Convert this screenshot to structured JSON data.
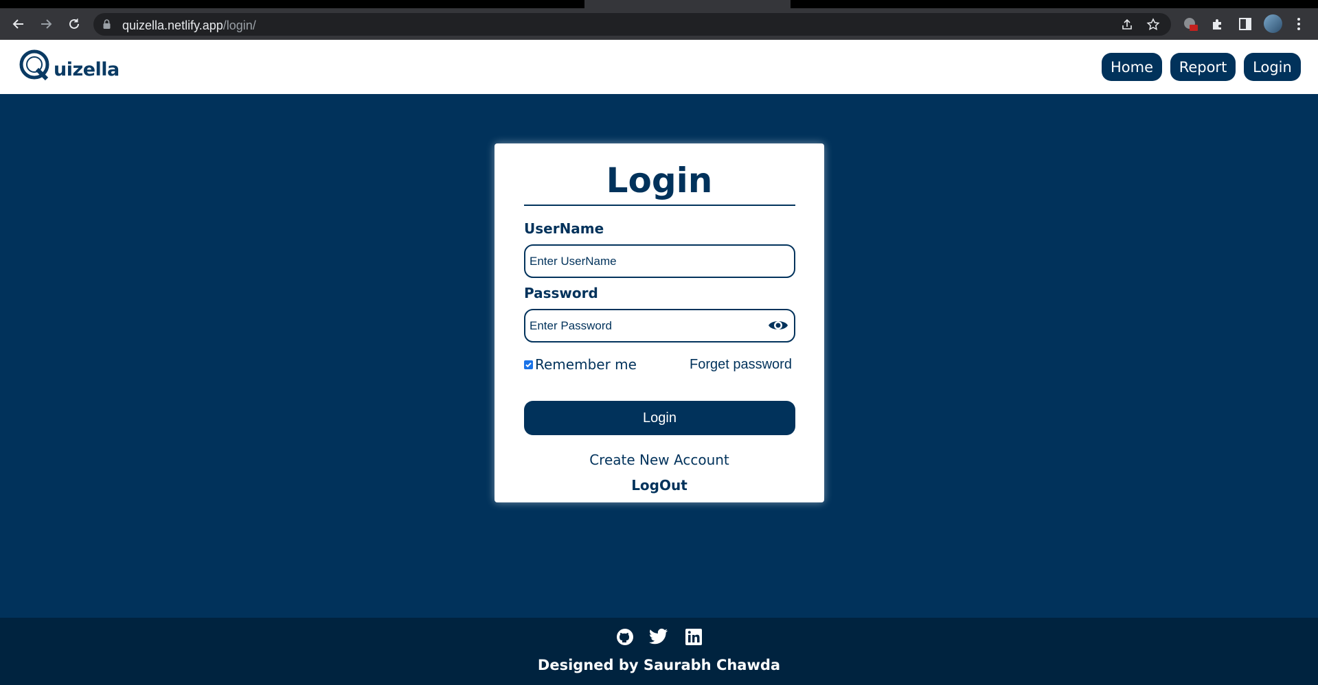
{
  "browser": {
    "url_host": "quizella.netlify.app",
    "url_path": "/login/"
  },
  "header": {
    "logo_text": "uizella",
    "nav": [
      {
        "label": "Home"
      },
      {
        "label": "Report"
      },
      {
        "label": "Login"
      }
    ]
  },
  "login_form": {
    "title": "Login",
    "username_label": "UserName",
    "username_placeholder": "Enter UserName",
    "password_label": "Password",
    "password_placeholder": "Enter Password",
    "remember_label": "Remember me",
    "remember_checked": true,
    "forgot_label": "Forget password",
    "submit_label": "Login",
    "create_account_label": "Create New Account",
    "logout_label": "LogOut"
  },
  "footer": {
    "social_icons": [
      "github-icon",
      "twitter-icon",
      "linkedin-icon"
    ],
    "credit": "Designed by Saurabh Chawda"
  },
  "colors": {
    "brand": "#01325b",
    "footer_bg": "#00233f",
    "checkbox": "#1a73e8"
  }
}
